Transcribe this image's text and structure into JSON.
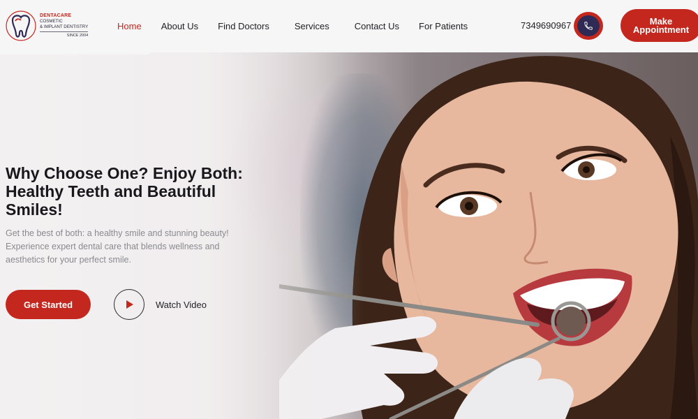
{
  "brand": {
    "name": "DENTACARE",
    "line2": "COSMETIC",
    "line3": "& IMPLANT DENTISTRY",
    "since": "SINCE 2004"
  },
  "nav": {
    "items": [
      {
        "label": "Home",
        "active": true
      },
      {
        "label": "About Us",
        "active": false
      },
      {
        "label": "Find Doctors",
        "active": false
      },
      {
        "label": "Services",
        "active": false
      },
      {
        "label": "Contact Us",
        "active": false
      },
      {
        "label": "For Patients",
        "active": false
      }
    ]
  },
  "contact": {
    "phone": "7349690967",
    "phone_icon": "phone-icon"
  },
  "cta": {
    "appointment_label": "Make Appointment"
  },
  "hero": {
    "title": "Why Choose One? Enjoy Both: Healthy Teeth and Beautiful Smiles!",
    "subtitle": "Get the best of both: a healthy smile and stunning beauty! Experience expert dental care that blends wellness and aesthetics for your perfect smile.",
    "primary_button": "Get Started",
    "video_label": "Watch Video",
    "video_icon": "play-icon"
  },
  "colors": {
    "accent": "#c4271e",
    "navy": "#2e2a55",
    "text": "#1e1e24",
    "muted": "#8a8a8e"
  }
}
